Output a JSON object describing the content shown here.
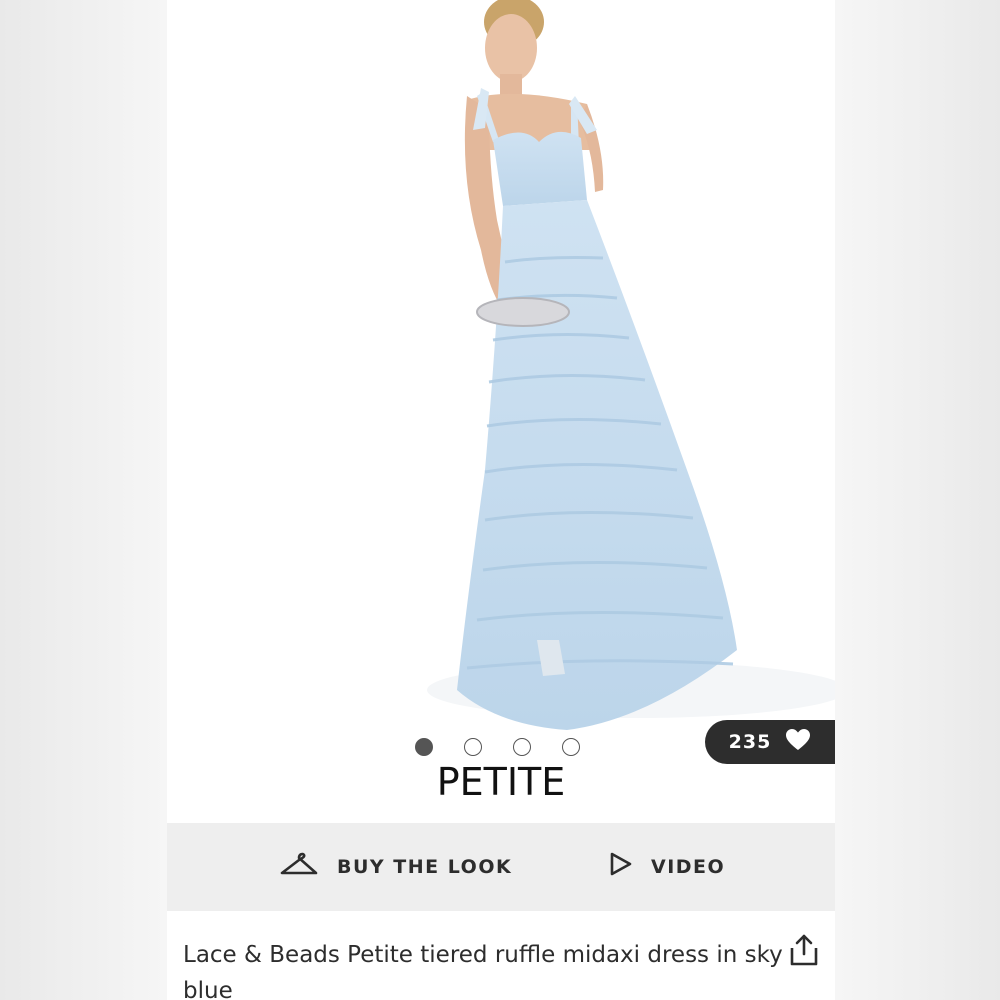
{
  "gallery": {
    "likes_count": "235",
    "slide_count": 4,
    "active_slide": 1,
    "badge_label": "PETITE"
  },
  "actions": {
    "buy_the_look": "BUY THE LOOK",
    "video": "VIDEO"
  },
  "product": {
    "title": "Lace & Beads Petite tiered ruffle midaxi dress in sky blue"
  },
  "icons": [
    "hanger-icon",
    "play-icon",
    "heart-icon",
    "share-icon"
  ],
  "colors": {
    "badge_bg": "#2d2d2d",
    "action_bar_bg": "#eeeeee",
    "dress": "#c6dcef"
  }
}
